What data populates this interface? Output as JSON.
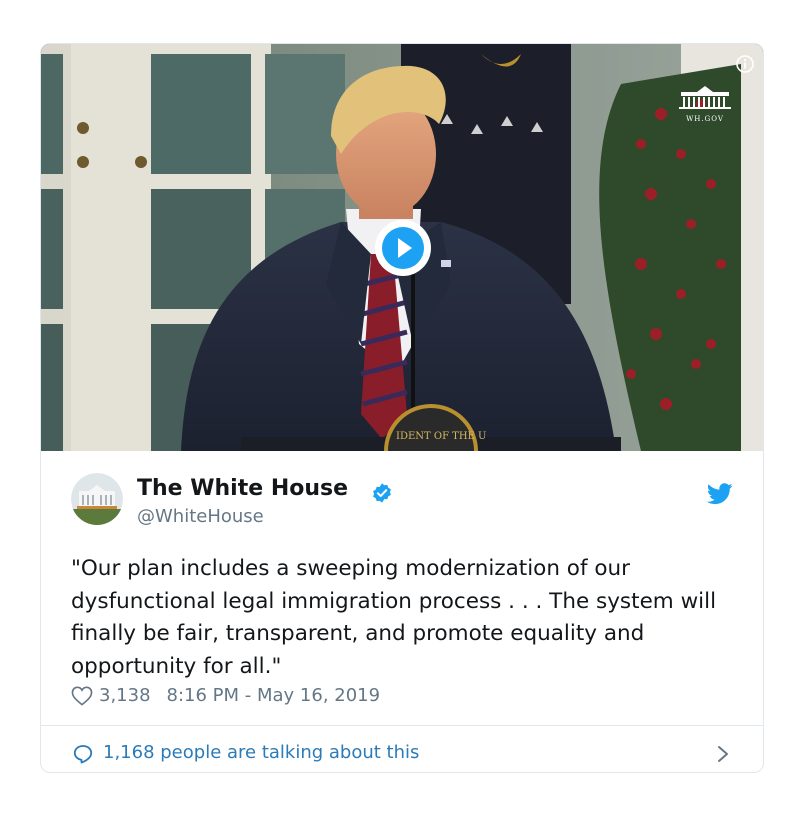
{
  "media": {
    "logo_text": "WH.GOV",
    "podium_seal_text": "IDENT OF THE U",
    "icons": {
      "info": "info-icon",
      "play": "play-icon"
    }
  },
  "tweet": {
    "author_name": "The White House",
    "handle": "@WhiteHouse",
    "text": "\"Our plan includes a sweeping modernization of our dysfunctional legal immigration process . . . The system will finally be fair, transparent, and promote equality and opportunity for all.\"",
    "like_count": "3,138",
    "timestamp": "8:16 PM - May 16, 2019",
    "talking_label": "1,168 people are talking about this",
    "icons": {
      "verified": "verified-badge-icon",
      "platform": "twitter-bird-icon",
      "like": "heart-icon",
      "reply": "speech-bubble-icon",
      "more": "chevron-right-icon"
    }
  },
  "colors": {
    "verified": "#1da1f2",
    "twitter_blue": "#1da1f2",
    "link": "#2b7bb9",
    "text": "#14171a",
    "muted": "#657786",
    "border": "#e1e8ed"
  }
}
